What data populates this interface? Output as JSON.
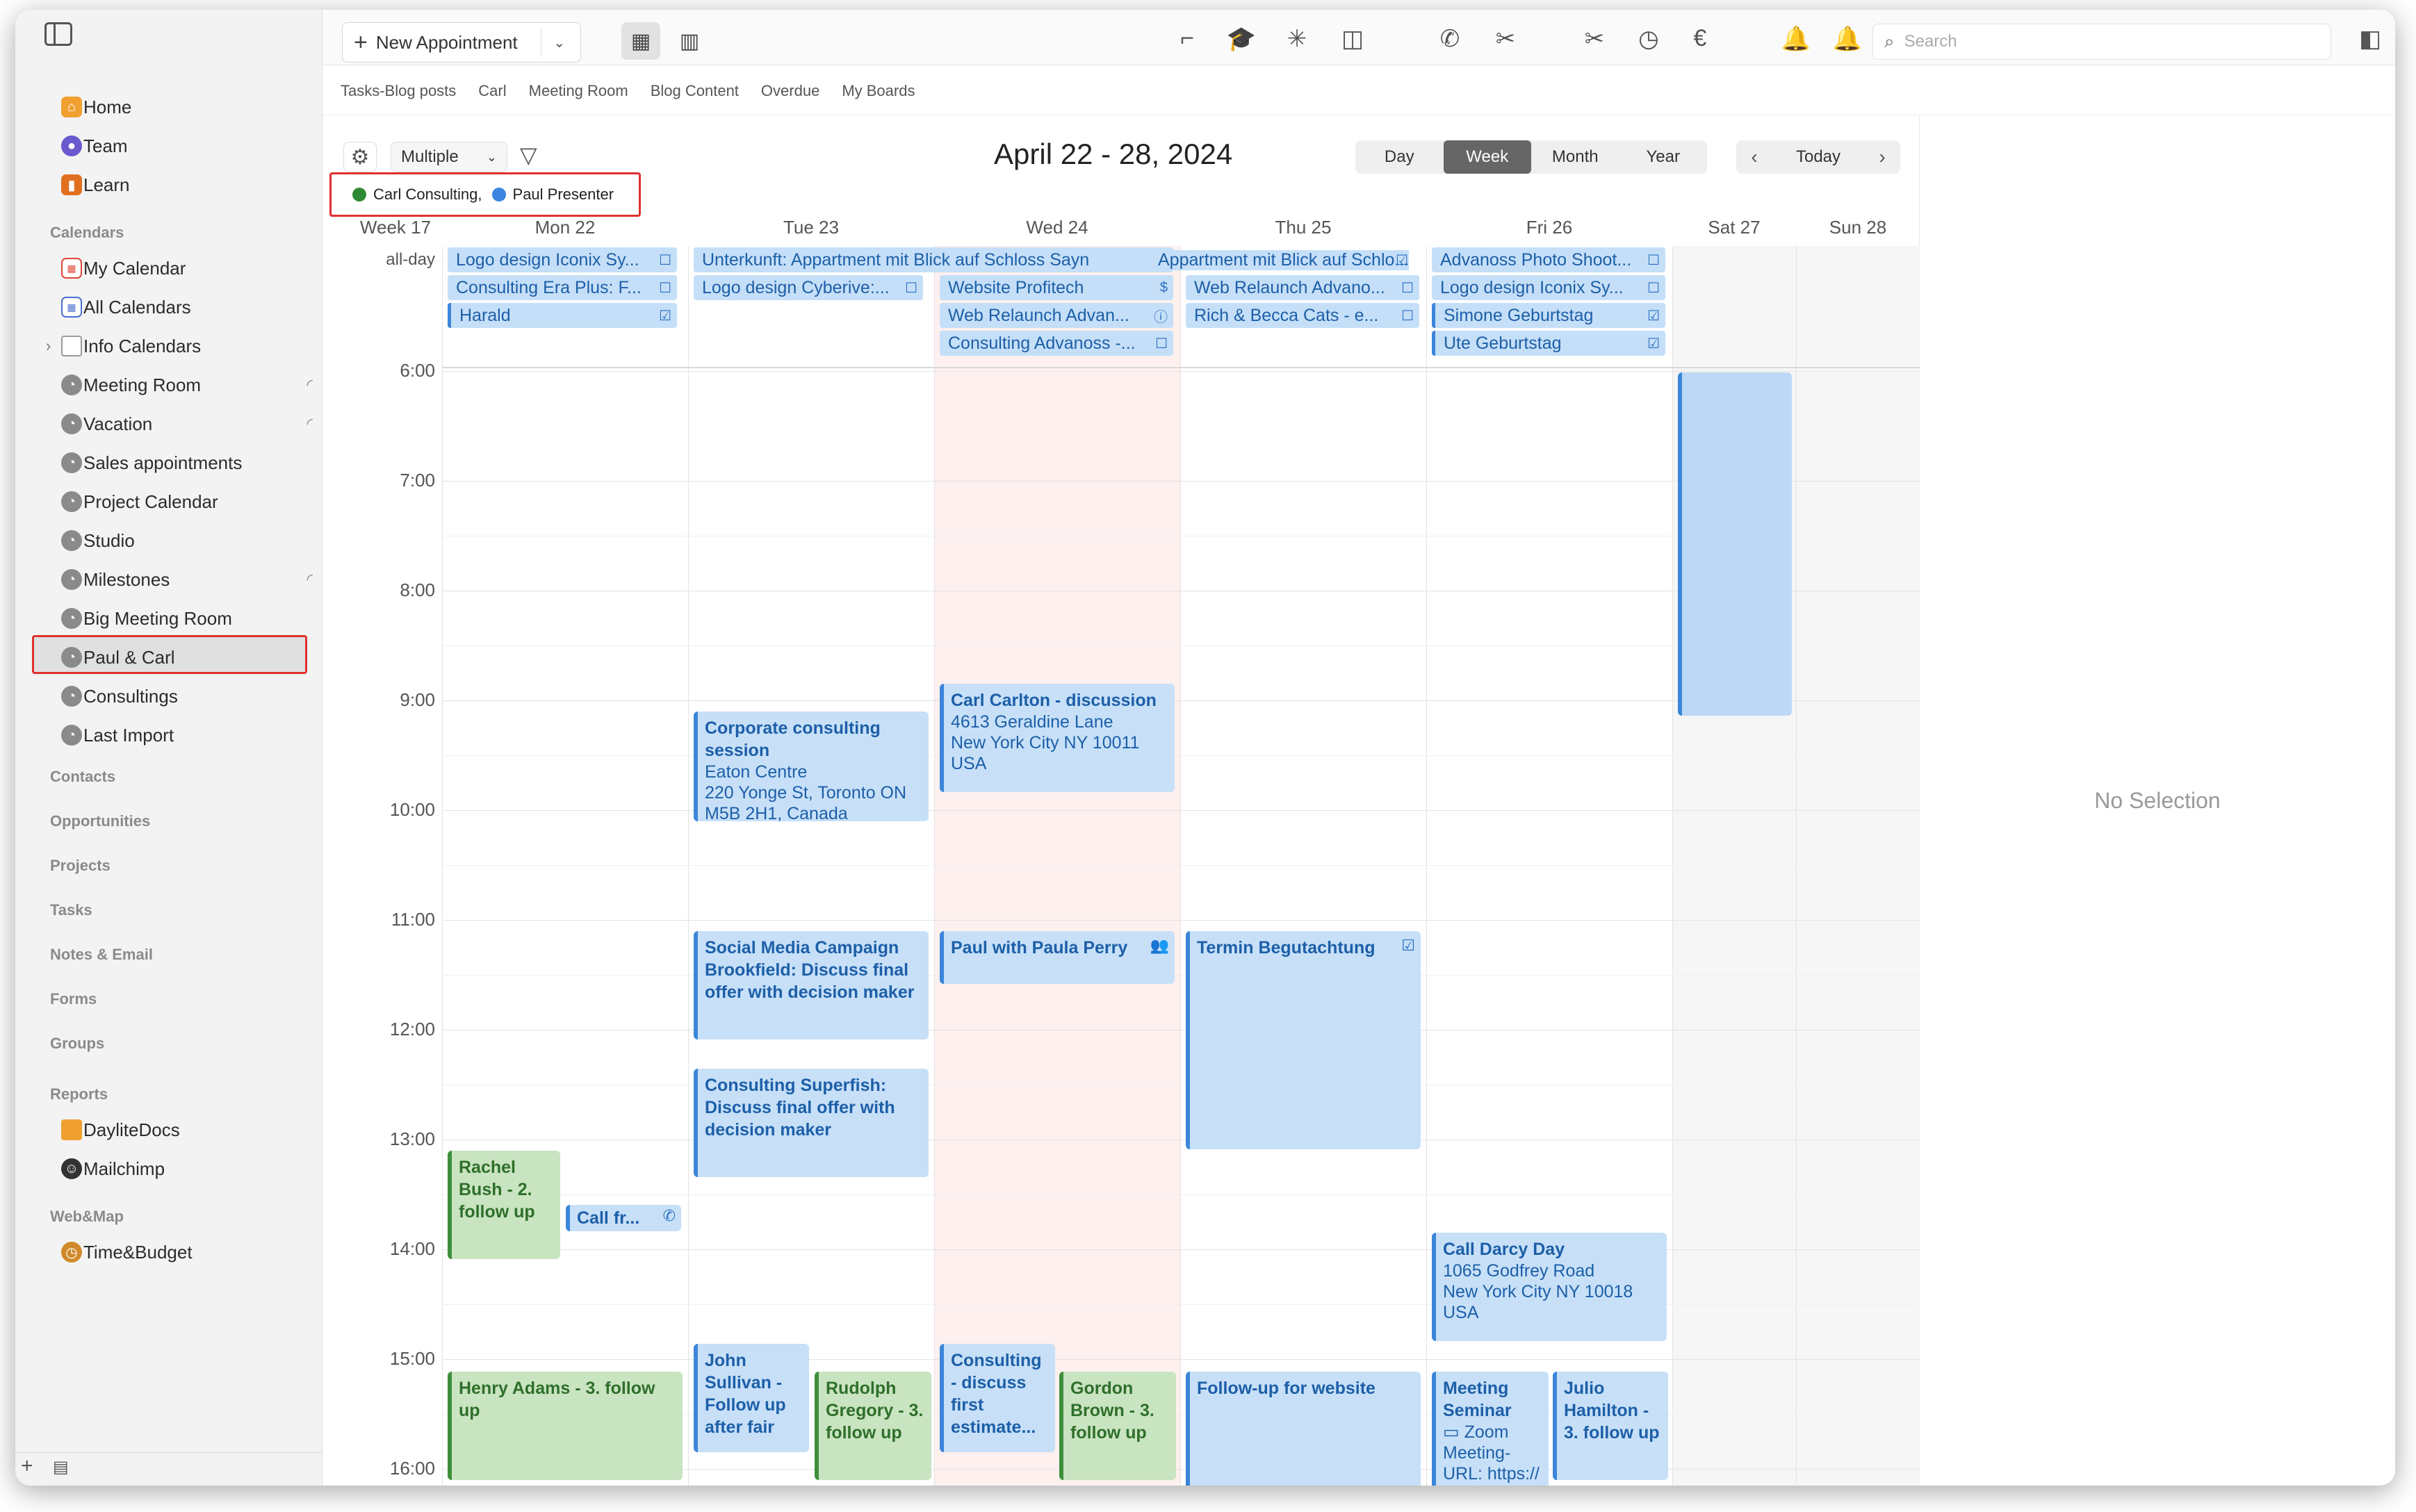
{
  "sidebar": {
    "items": [
      {
        "label": "Home",
        "icon": "home-icon",
        "color": "#f0a030"
      },
      {
        "label": "Team",
        "icon": "team-icon",
        "color": "#6a5acd"
      },
      {
        "label": "Learn",
        "icon": "book-icon",
        "color": "#e07020"
      }
    ],
    "calendars_heading": "Calendars",
    "calendars": [
      {
        "label": "My Calendar",
        "icon": "calendar-icon",
        "color": "#e0463a",
        "shared": false
      },
      {
        "label": "All Calendars",
        "icon": "calendar-icon",
        "color": "#4a6fd1",
        "shared": false
      },
      {
        "label": "Info Calendars",
        "icon": "folder-icon",
        "color": "#888888",
        "shared": false
      },
      {
        "label": "Meeting Room",
        "icon": "shared-calendar-icon",
        "color": "#777777",
        "shared": true
      },
      {
        "label": "Vacation",
        "icon": "shared-calendar-icon",
        "color": "#777777",
        "shared": true
      },
      {
        "label": "Sales appointments",
        "icon": "shared-calendar-icon",
        "color": "#777777",
        "shared": false
      },
      {
        "label": "Project Calendar",
        "icon": "shared-calendar-icon",
        "color": "#777777",
        "shared": false
      },
      {
        "label": "Studio",
        "icon": "shared-calendar-icon",
        "color": "#777777",
        "shared": false
      },
      {
        "label": "Milestones",
        "icon": "shared-calendar-icon",
        "color": "#777777",
        "shared": true
      },
      {
        "label": "Big Meeting Room",
        "icon": "shared-calendar-icon",
        "color": "#777777",
        "shared": false
      },
      {
        "label": "Paul & Carl",
        "icon": "shared-calendar-icon",
        "color": "#777777",
        "shared": false
      },
      {
        "label": "Consultings",
        "icon": "shared-calendar-icon",
        "color": "#777777",
        "shared": false
      },
      {
        "label": "Last Import",
        "icon": "shared-calendar-icon",
        "color": "#777777",
        "shared": false
      }
    ],
    "sections": [
      "Contacts",
      "Opportunities",
      "Projects",
      "Tasks",
      "Notes & Email",
      "Forms",
      "Groups"
    ],
    "reports_heading": "Reports",
    "reports": [
      {
        "label": "DayliteDocs",
        "icon": "folder-icon",
        "color": "#f0a030"
      },
      {
        "label": "Mailchimp",
        "icon": "mailchimp-icon",
        "color": "#333333"
      }
    ],
    "web_heading": "Web&Map",
    "web": [
      {
        "label": "Time&Budget",
        "icon": "time-budget-icon",
        "color": "#d08a2a"
      }
    ]
  },
  "toolbar": {
    "new_appointment": "New Appointment",
    "search_placeholder": "Search"
  },
  "favorites": [
    "Tasks-Blog posts",
    "Carl",
    "Meeting Room",
    "Blog Content",
    "Overdue",
    "My Boards"
  ],
  "calendar": {
    "view_selector": "Multiple",
    "title": "April 22 - 28, 2024",
    "views": [
      "Day",
      "Week",
      "Month",
      "Year"
    ],
    "active_view": "Week",
    "today_label": "Today",
    "filter_calendars": [
      {
        "label": "Carl Consulting,",
        "color": "#2e8b34"
      },
      {
        "label": "Paul Presenter",
        "color": "#3b86e0"
      }
    ],
    "week_label": "Week 17",
    "days": [
      "Mon 22",
      "Tue 23",
      "Wed 24",
      "Thu 25",
      "Fri 26",
      "Sat 27",
      "Sun 28"
    ],
    "allday_label": "all-day",
    "times": [
      "6:00",
      "7:00",
      "8:00",
      "9:00",
      "10:00",
      "11:00",
      "12:00",
      "13:00",
      "14:00",
      "15:00",
      "16:00"
    ],
    "allday_events": [
      "Logo design Iconix Sy...",
      "Consulting Era Plus: F...",
      "Harald",
      "Unterkunft: Appartment mit Blick auf Schloss Sayn",
      "Appartment mit Blick auf Schlo...",
      "Logo design Cyberive:...",
      "Website Profitech",
      "Web Relaunch Advan...",
      "Consulting Advanoss -...",
      "Web Relaunch Advano...",
      "Rich & Becca Cats - e...",
      "Advanoss Photo Shoot...",
      "Logo design Iconix Sy...",
      "Simone Geburtstag",
      "Ute Geburtstag"
    ],
    "events": {
      "corporate_title": "Corporate consulting session",
      "corporate_loc1": "Eaton Centre",
      "corporate_loc2": "220 Yonge St, Toronto ON M5B 2H1, Canada",
      "carlton_title": "Carl Carlton - discussion",
      "carlton_loc1": "4613 Geraldine Lane",
      "carlton_loc2": "New York City  NY 10011",
      "carlton_loc3": "USA",
      "social_title": "Social Media Campaign Brookfield: Discuss final offer with decision maker",
      "paul_title": "Paul with Paula Perry",
      "termin_title": "Termin Begutachtung",
      "superfish_title": "Consulting Superfish: Discuss final offer with decision maker",
      "rachel_title": "Rachel Bush - 2. follow up",
      "callfr_title": "Call fr...",
      "darcy_title": "Call Darcy Day",
      "darcy_loc1": "1065 Godfrey Road",
      "darcy_loc2": "New York City  NY 10018",
      "darcy_loc3": "USA",
      "henry_title": "Henry Adams - 3. follow up",
      "john_title": "John Sullivan - Follow up after fair",
      "rudolph_title": "Rudolph Gregory - 3. follow up",
      "consulting_title": "Consulting - discuss first estimate...",
      "gordon_title": "Gordon Brown - 3. follow up",
      "followup_title": "Follow-up for website",
      "seminar_title": "Meeting Seminar",
      "seminar_sub": "Zoom Meeting-URL: https://",
      "julio_title": "Julio Hamilton - 3. follow up"
    }
  },
  "inspector": {
    "empty": "No Selection"
  }
}
